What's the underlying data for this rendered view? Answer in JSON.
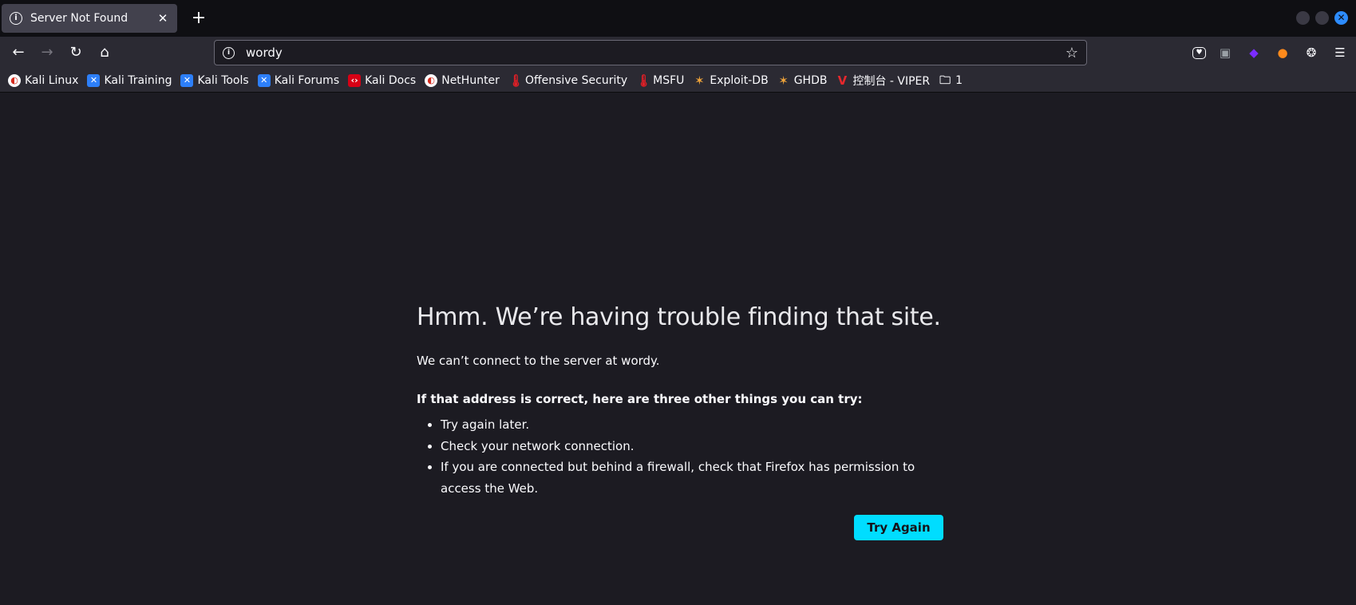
{
  "tab": {
    "title": "Server Not Found",
    "icon": "info-icon",
    "close_icon": "close-icon"
  },
  "new_tab_icon": "plus-icon",
  "nav": {
    "back_icon": "arrow-left-icon",
    "forward_icon": "arrow-right-icon",
    "reload_icon": "reload-icon",
    "home_icon": "home-icon"
  },
  "urlbar": {
    "value": "wordy",
    "icon": "info-icon",
    "bookmark_icon": "star-icon"
  },
  "toolbar_right": [
    "pocket-icon",
    "extension-icon",
    "extension-icon",
    "extension-icon",
    "cookie-icon",
    "menu-icon"
  ],
  "bookmarks": [
    {
      "label": "Kali Linux",
      "icon": "kali-icon"
    },
    {
      "label": "Kali Training",
      "icon": "kali-training-icon"
    },
    {
      "label": "Kali Tools",
      "icon": "kali-tools-icon"
    },
    {
      "label": "Kali Forums",
      "icon": "kali-forums-icon"
    },
    {
      "label": "Kali Docs",
      "icon": "kali-docs-icon"
    },
    {
      "label": "NetHunter",
      "icon": "kali-icon"
    },
    {
      "label": "Offensive Security",
      "icon": "offsec-icon"
    },
    {
      "label": "MSFU",
      "icon": "offsec-icon"
    },
    {
      "label": "Exploit-DB",
      "icon": "exploit-db-icon"
    },
    {
      "label": "GHDB",
      "icon": "exploit-db-icon"
    },
    {
      "label": "控制台 - VIPER",
      "icon": "viper-icon"
    },
    {
      "label": "1",
      "icon": "folder-icon"
    }
  ],
  "error": {
    "title": "Hmm. We’re having trouble finding that site.",
    "description": "We can’t connect to the server at wordy.",
    "try_header": "If that address is correct, here are three other things you can try:",
    "suggestions": [
      "Try again later.",
      "Check your network connection.",
      "If you are connected but behind a firewall, check that Firefox has permission to access the Web."
    ],
    "button_label": "Try Again"
  },
  "colors": {
    "accent": "#00ddff",
    "page_bg": "#1c1b22",
    "toolbar_bg": "#2b2a33"
  }
}
